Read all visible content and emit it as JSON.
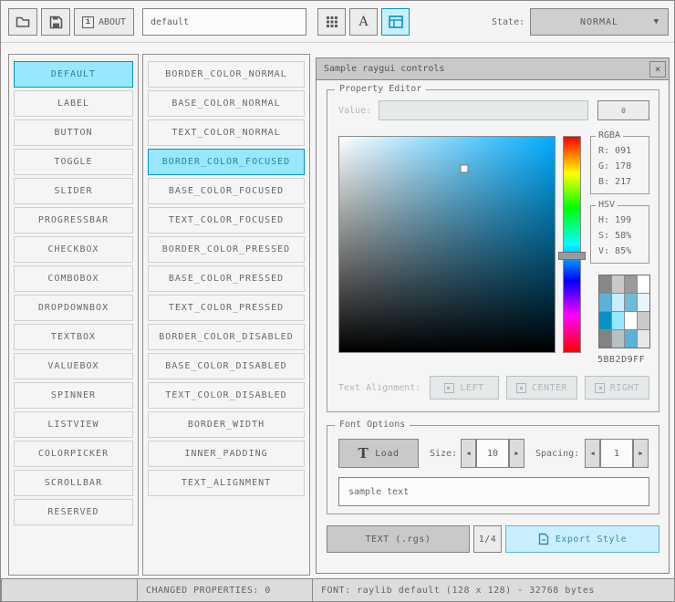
{
  "toolbar": {
    "about_label": "ABOUT",
    "style_name_value": "default",
    "state_label": "State:",
    "state_value": "NORMAL"
  },
  "controls_list": {
    "items": [
      "DEFAULT",
      "LABEL",
      "BUTTON",
      "TOGGLE",
      "SLIDER",
      "PROGRESSBAR",
      "CHECKBOX",
      "COMBOBOX",
      "DROPDOWNBOX",
      "TEXTBOX",
      "VALUEBOX",
      "SPINNER",
      "LISTVIEW",
      "COLORPICKER",
      "SCROLLBAR",
      "RESERVED"
    ],
    "selected_index": 0
  },
  "properties_list": {
    "items": [
      "BORDER_COLOR_NORMAL",
      "BASE_COLOR_NORMAL",
      "TEXT_COLOR_NORMAL",
      "BORDER_COLOR_FOCUSED",
      "BASE_COLOR_FOCUSED",
      "TEXT_COLOR_FOCUSED",
      "BORDER_COLOR_PRESSED",
      "BASE_COLOR_PRESSED",
      "TEXT_COLOR_PRESSED",
      "BORDER_COLOR_DISABLED",
      "BASE_COLOR_DISABLED",
      "TEXT_COLOR_DISABLED",
      "BORDER_WIDTH",
      "INNER_PADDING",
      "TEXT_ALIGNMENT"
    ],
    "selected_index": 3
  },
  "sample_window": {
    "title": "Sample raygui controls"
  },
  "property_editor": {
    "group_label": "Property Editor",
    "value_label": "Value:",
    "value_input": "",
    "value_button_label": "0",
    "rgba": {
      "label": "RGBA",
      "r_label": "R: 091",
      "g_label": "G: 178",
      "b_label": "B: 217"
    },
    "hsv": {
      "label": "HSV",
      "h": 199,
      "s": 58,
      "v": 85,
      "h_label": "H: 199",
      "s_label": "S: 58%",
      "v_label": "V: 85%"
    },
    "picker": {
      "hue_color": "#00AEFF"
    },
    "hex_value": "5BB2D9FF",
    "swatches": [
      "#878787",
      "#c9c9c9",
      "#9a9a9a",
      "#ffffff",
      "#5bb2d9",
      "#c9effe",
      "#6dbcd9",
      "#e8f6fc",
      "#0492c7",
      "#97e8ff",
      "#ffffff",
      "#c9c9c9",
      "#838383",
      "#b5c1c2",
      "#5bb2d9",
      "#e6e9e9"
    ],
    "text_alignment_label": "Text Alignment:",
    "alignment_buttons": [
      "LEFT",
      "CENTER",
      "RIGHT"
    ]
  },
  "font_options": {
    "group_label": "Font Options",
    "load_label": "Load",
    "size_label": "Size:",
    "size_value": "10",
    "spacing_label": "Spacing:",
    "spacing_value": "1",
    "sample_text": "sample text"
  },
  "actions": {
    "export_text_label": "TEXT (.rgs)",
    "page_label": "1/4",
    "export_style_label": "Export Style"
  },
  "statusbar": {
    "changed_properties": "CHANGED PROPERTIES: 0",
    "font_info": "FONT: raylib default (128 x 128) - 32768 bytes"
  },
  "icons": {
    "dropdown_arrow": "▼",
    "spinner_left": "◀",
    "spinner_right": "▶",
    "close": "×",
    "info": "i",
    "font_letter": "A",
    "load_font_letter": "T"
  },
  "colors": {
    "accent_border": "#0492c7",
    "accent_base": "#97e8ff",
    "focused_border": "#5bb2d9",
    "focused_base": "#c9effe",
    "border_normal": "#838383",
    "text_normal": "#686868",
    "disabled_border": "#b5c1c2",
    "disabled_base": "#e6e9e9",
    "disabled_text": "#aeb7b8"
  }
}
